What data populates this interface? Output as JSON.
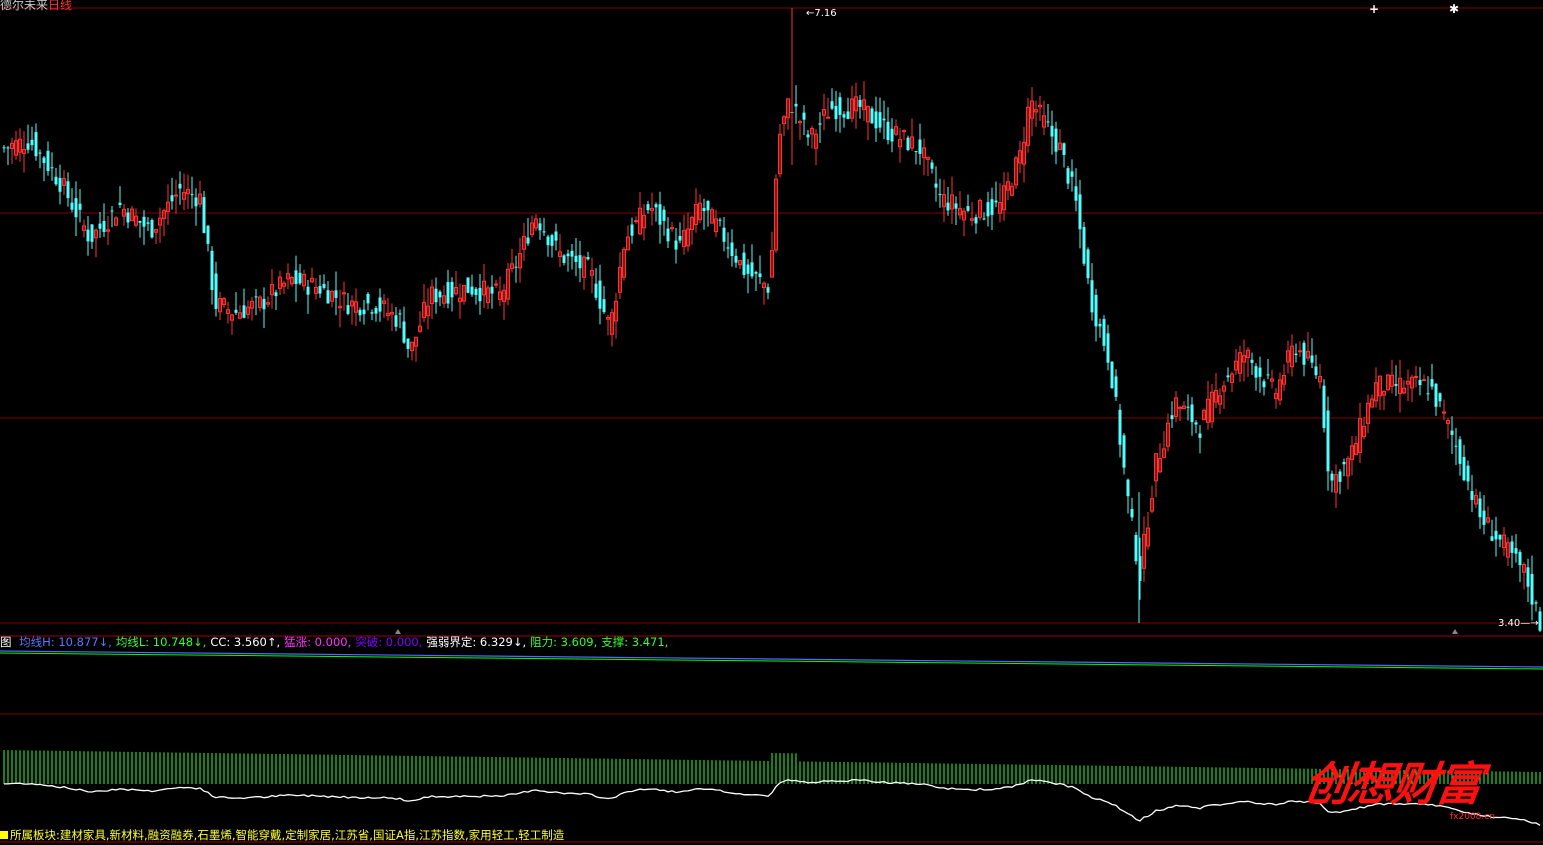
{
  "window": {
    "title_prefix": "德尔未来",
    "title_period": "日线"
  },
  "colors": {
    "up": "#ff3232",
    "down": "#54fcfc",
    "grid": "#800000",
    "ma_h": "#4d6bff",
    "ma_l": "#00ff00",
    "volume_bar": "#33ff33",
    "watermark": "#ff1010"
  },
  "price_chart": {
    "high_label": "7.16",
    "low_label": "3.40",
    "high_value": 7.16,
    "low_value": 3.4
  },
  "top_icons": [
    "cross-icon",
    "asterisk-icon"
  ],
  "indicator_bar": {
    "prefix": "图",
    "items": [
      {
        "text": "均线H: 10.877↓,",
        "color": "#5a78ff"
      },
      {
        "text": "均线L: 10.748↓,",
        "color": "#33ff33"
      },
      {
        "text": "CC: 3.560↑,",
        "color": "#ffffff"
      },
      {
        "text": "猛涨: 0.000,",
        "color": "#ff33ff"
      },
      {
        "text": "突破: 0.000,",
        "color": "#8000ff"
      },
      {
        "text": "强弱界定: 6.329↓,",
        "color": "#ffffff"
      },
      {
        "text": "阻力: 3.609,",
        "color": "#33ff33"
      },
      {
        "text": "支撑: 3.471,",
        "color": "#33ff33"
      }
    ]
  },
  "sectors": {
    "label": "所属板块:",
    "list": "建材家具,新材料,融资融券,石墨烯,智能穿戴,定制家居,江苏省,国证A指,江苏指数,家用轻工,轻工制造"
  },
  "watermark": {
    "text": "创想财富",
    "sub": "fx2008.cn"
  }
}
